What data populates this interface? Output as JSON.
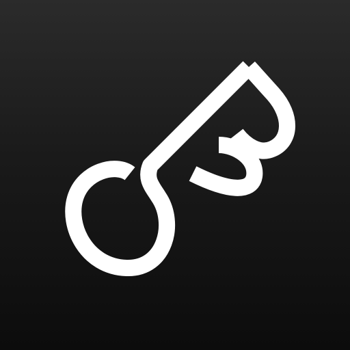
{
  "app_icon": {
    "name": "key-b-logo",
    "icon": "key-icon",
    "colors": {
      "background_top": "#2b2b2b",
      "background_bottom": "#0c0c0c",
      "glyph": "#ffffff"
    }
  }
}
